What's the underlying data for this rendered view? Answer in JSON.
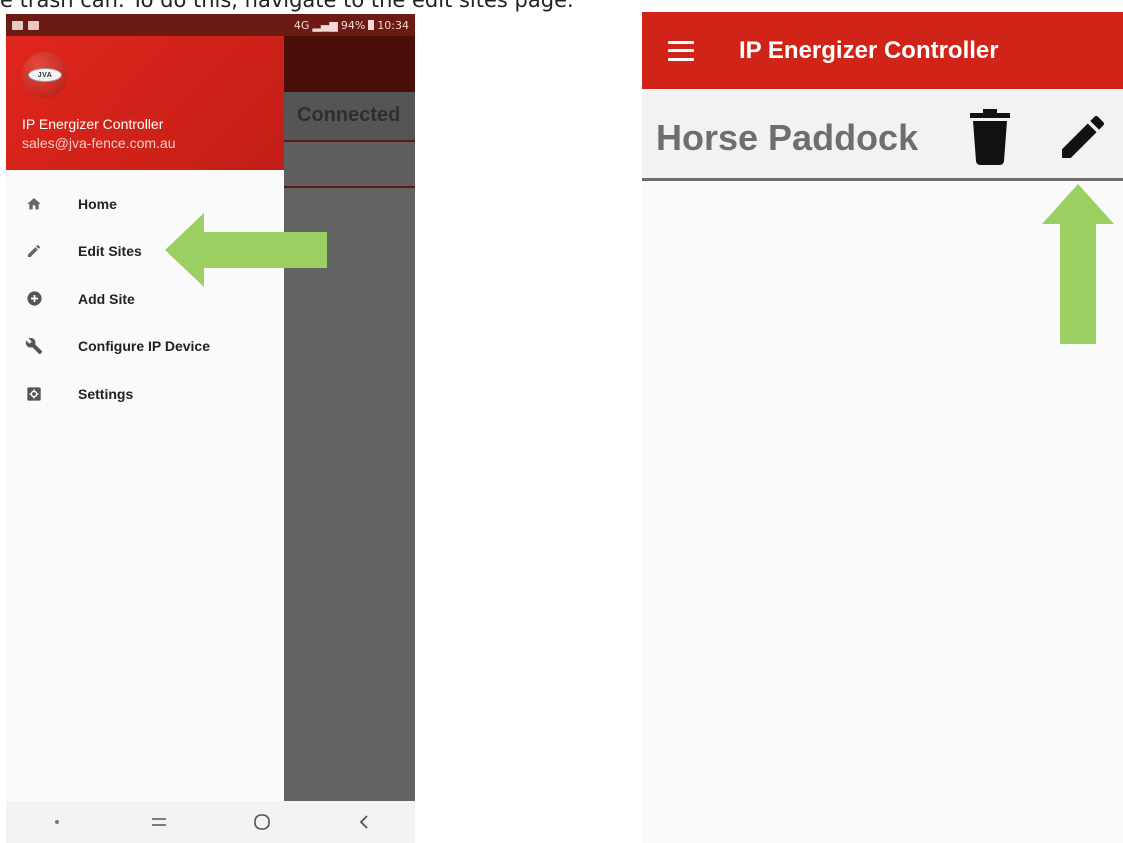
{
  "caption": "e trash can. To do this, navigate to the edit sites page.",
  "left_phone": {
    "status_bar": {
      "battery_percent": "94%",
      "time": "10:34",
      "signal": "4G"
    },
    "background_app": {
      "status_text": "Connected"
    },
    "drawer": {
      "logo_text": "JVA",
      "app_name": "IP Energizer Controller",
      "email": "sales@jva-fence.com.au",
      "menu": [
        {
          "label": "Home",
          "icon": "home-icon"
        },
        {
          "label": "Edit Sites",
          "icon": "pencil-icon"
        },
        {
          "label": "Add Site",
          "icon": "plus-circle-icon"
        },
        {
          "label": "Configure IP Device",
          "icon": "wrench-icon"
        },
        {
          "label": "Settings",
          "icon": "settings-icon"
        }
      ]
    },
    "nav_bar": {
      "buttons": [
        "dot",
        "recents",
        "home",
        "back"
      ]
    }
  },
  "right_phone": {
    "toolbar": {
      "title": "IP Energizer Controller"
    },
    "site": {
      "name": "Horse Paddock"
    }
  },
  "colors": {
    "brand_red": "#cf2417",
    "arrow_green": "#9ccf62",
    "drawer_background": "#fafafa",
    "scrim": "#636363"
  }
}
